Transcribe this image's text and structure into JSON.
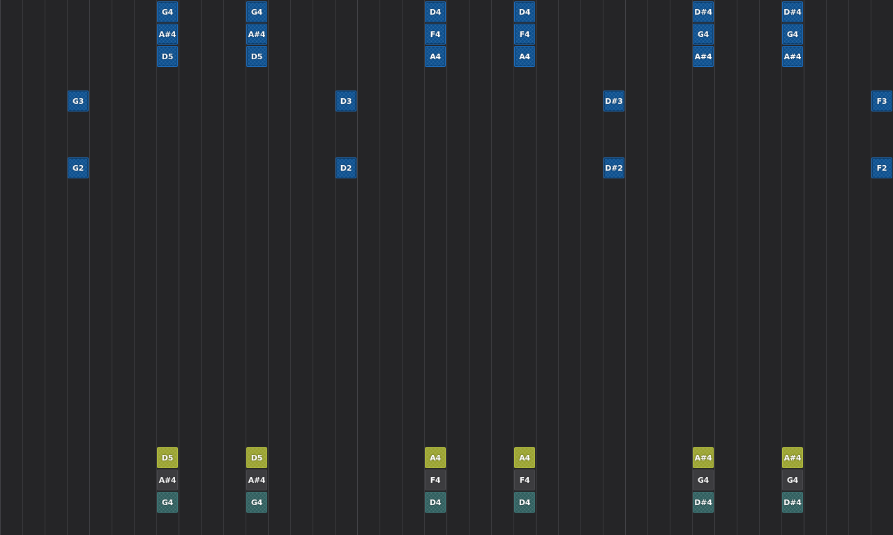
{
  "piano_roll": {
    "colors": {
      "background": "#252527",
      "grid_line": "#3a3a3d",
      "note_blue": "#0b4f8f",
      "note_lime": "#9aa32f",
      "note_gray": "#3c3c3f",
      "note_teal": "#2f5e5e"
    },
    "notes": [
      {
        "label": "G4",
        "color": "blue"
      },
      {
        "label": "A#4",
        "color": "blue"
      },
      {
        "label": "D5",
        "color": "blue"
      },
      {
        "label": "G4",
        "color": "blue"
      },
      {
        "label": "A#4",
        "color": "blue"
      },
      {
        "label": "D5",
        "color": "blue"
      },
      {
        "label": "D4",
        "color": "blue"
      },
      {
        "label": "F4",
        "color": "blue"
      },
      {
        "label": "A4",
        "color": "blue"
      },
      {
        "label": "D4",
        "color": "blue"
      },
      {
        "label": "F4",
        "color": "blue"
      },
      {
        "label": "A4",
        "color": "blue"
      },
      {
        "label": "D#4",
        "color": "blue"
      },
      {
        "label": "G4",
        "color": "blue"
      },
      {
        "label": "A#4",
        "color": "blue"
      },
      {
        "label": "D#4",
        "color": "blue"
      },
      {
        "label": "G4",
        "color": "blue"
      },
      {
        "label": "A#4",
        "color": "blue"
      },
      {
        "label": "G3",
        "color": "blue"
      },
      {
        "label": "D3",
        "color": "blue"
      },
      {
        "label": "D#3",
        "color": "blue"
      },
      {
        "label": "F3",
        "color": "blue"
      },
      {
        "label": "G2",
        "color": "blue"
      },
      {
        "label": "D2",
        "color": "blue"
      },
      {
        "label": "D#2",
        "color": "blue"
      },
      {
        "label": "F2",
        "color": "blue"
      },
      {
        "label": "D5",
        "color": "lime"
      },
      {
        "label": "A#4",
        "color": "gray"
      },
      {
        "label": "G4",
        "color": "teal"
      },
      {
        "label": "D5",
        "color": "lime"
      },
      {
        "label": "A#4",
        "color": "gray"
      },
      {
        "label": "G4",
        "color": "teal"
      },
      {
        "label": "A4",
        "color": "lime"
      },
      {
        "label": "F4",
        "color": "gray"
      },
      {
        "label": "D4",
        "color": "teal"
      },
      {
        "label": "A4",
        "color": "lime"
      },
      {
        "label": "F4",
        "color": "gray"
      },
      {
        "label": "D4",
        "color": "teal"
      },
      {
        "label": "A#4",
        "color": "lime"
      },
      {
        "label": "G4",
        "color": "gray"
      },
      {
        "label": "D#4",
        "color": "teal"
      },
      {
        "label": "A#4",
        "color": "lime"
      },
      {
        "label": "G4",
        "color": "gray"
      },
      {
        "label": "D#4",
        "color": "teal"
      }
    ]
  }
}
